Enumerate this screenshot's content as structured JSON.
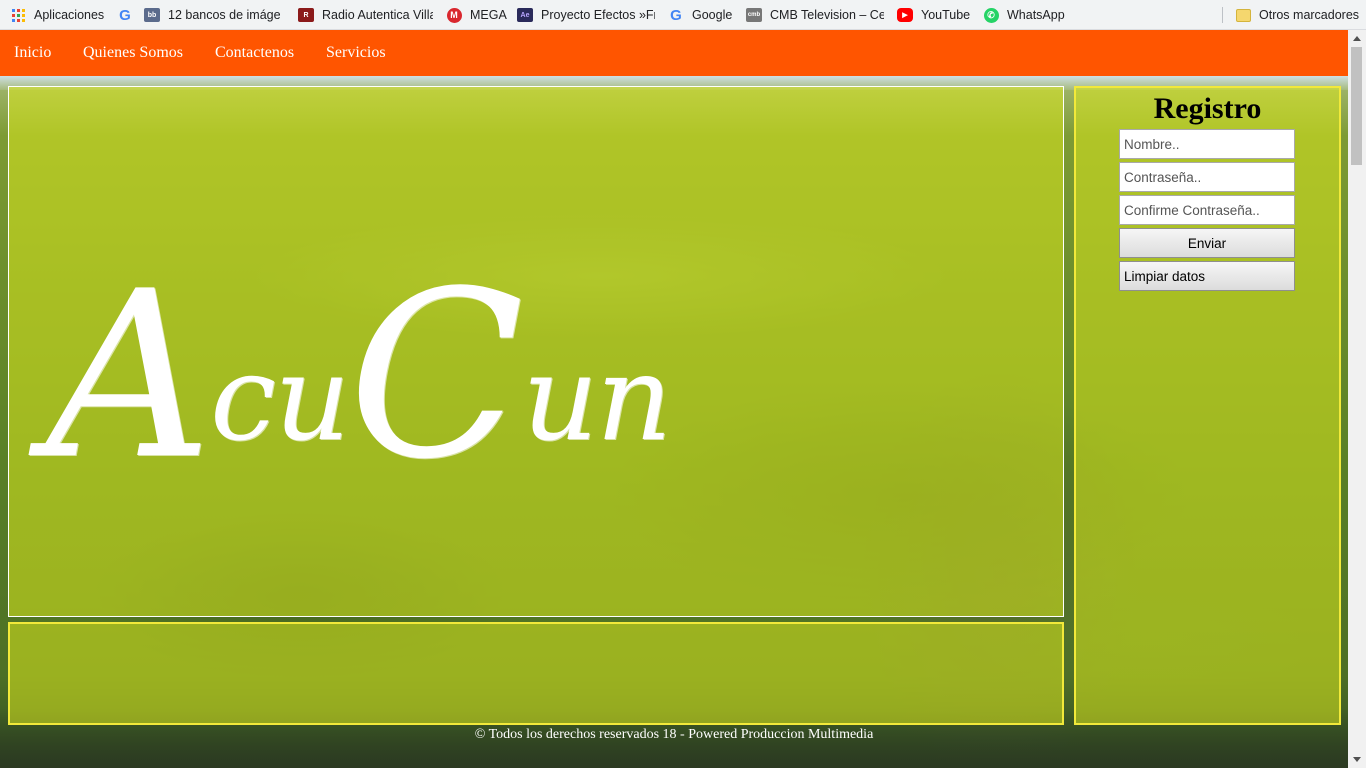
{
  "bookmarks": {
    "items": [
      {
        "label": "Aplicaciones",
        "icon": "apps-grid-icon"
      },
      {
        "label": "",
        "icon": "google-icon"
      },
      {
        "label": "12 bancos de imáge",
        "icon": "image-bank-icon"
      },
      {
        "label": "Radio Autentica Villa",
        "icon": "radio-icon"
      },
      {
        "label": "MEGA",
        "icon": "mega-icon"
      },
      {
        "label": "Proyecto Efectos »Fr",
        "icon": "after-effects-icon"
      },
      {
        "label": "Google",
        "icon": "google-icon"
      },
      {
        "label": "CMB Television – Cen",
        "icon": "cmb-icon"
      },
      {
        "label": "YouTube",
        "icon": "youtube-icon"
      },
      {
        "label": "WhatsApp",
        "icon": "whatsapp-icon"
      }
    ],
    "other": "Otros marcadores",
    "icon_glyphs": {
      "google": "G",
      "image_bank": "bb",
      "radio": "R",
      "mega": "M",
      "after_effects": "Ae",
      "cmb": "cmb",
      "youtube": "▶",
      "whatsapp": "✆"
    }
  },
  "nav": {
    "items": [
      "Inicio",
      "Quienes Somos",
      "Contactenos",
      "Servicios"
    ]
  },
  "hero": {
    "logo_big_1": "A",
    "logo_small_1": "cu",
    "logo_big_2": "C",
    "logo_small_2": "un"
  },
  "registro": {
    "title": "Registro",
    "nombre_placeholder": "Nombre..",
    "contrasena_placeholder": "Contraseña..",
    "confirme_placeholder": "Confirme Contraseña..",
    "enviar_label": "Enviar",
    "limpiar_label": "Limpiar datos"
  },
  "footer": {
    "text": "© Todos los derechos reservados 18 - Powered Produccion Multimedia"
  },
  "colors": {
    "navbar": "#ff5500",
    "box_tint": "#dae81e",
    "box_border": "#f2e93a"
  }
}
